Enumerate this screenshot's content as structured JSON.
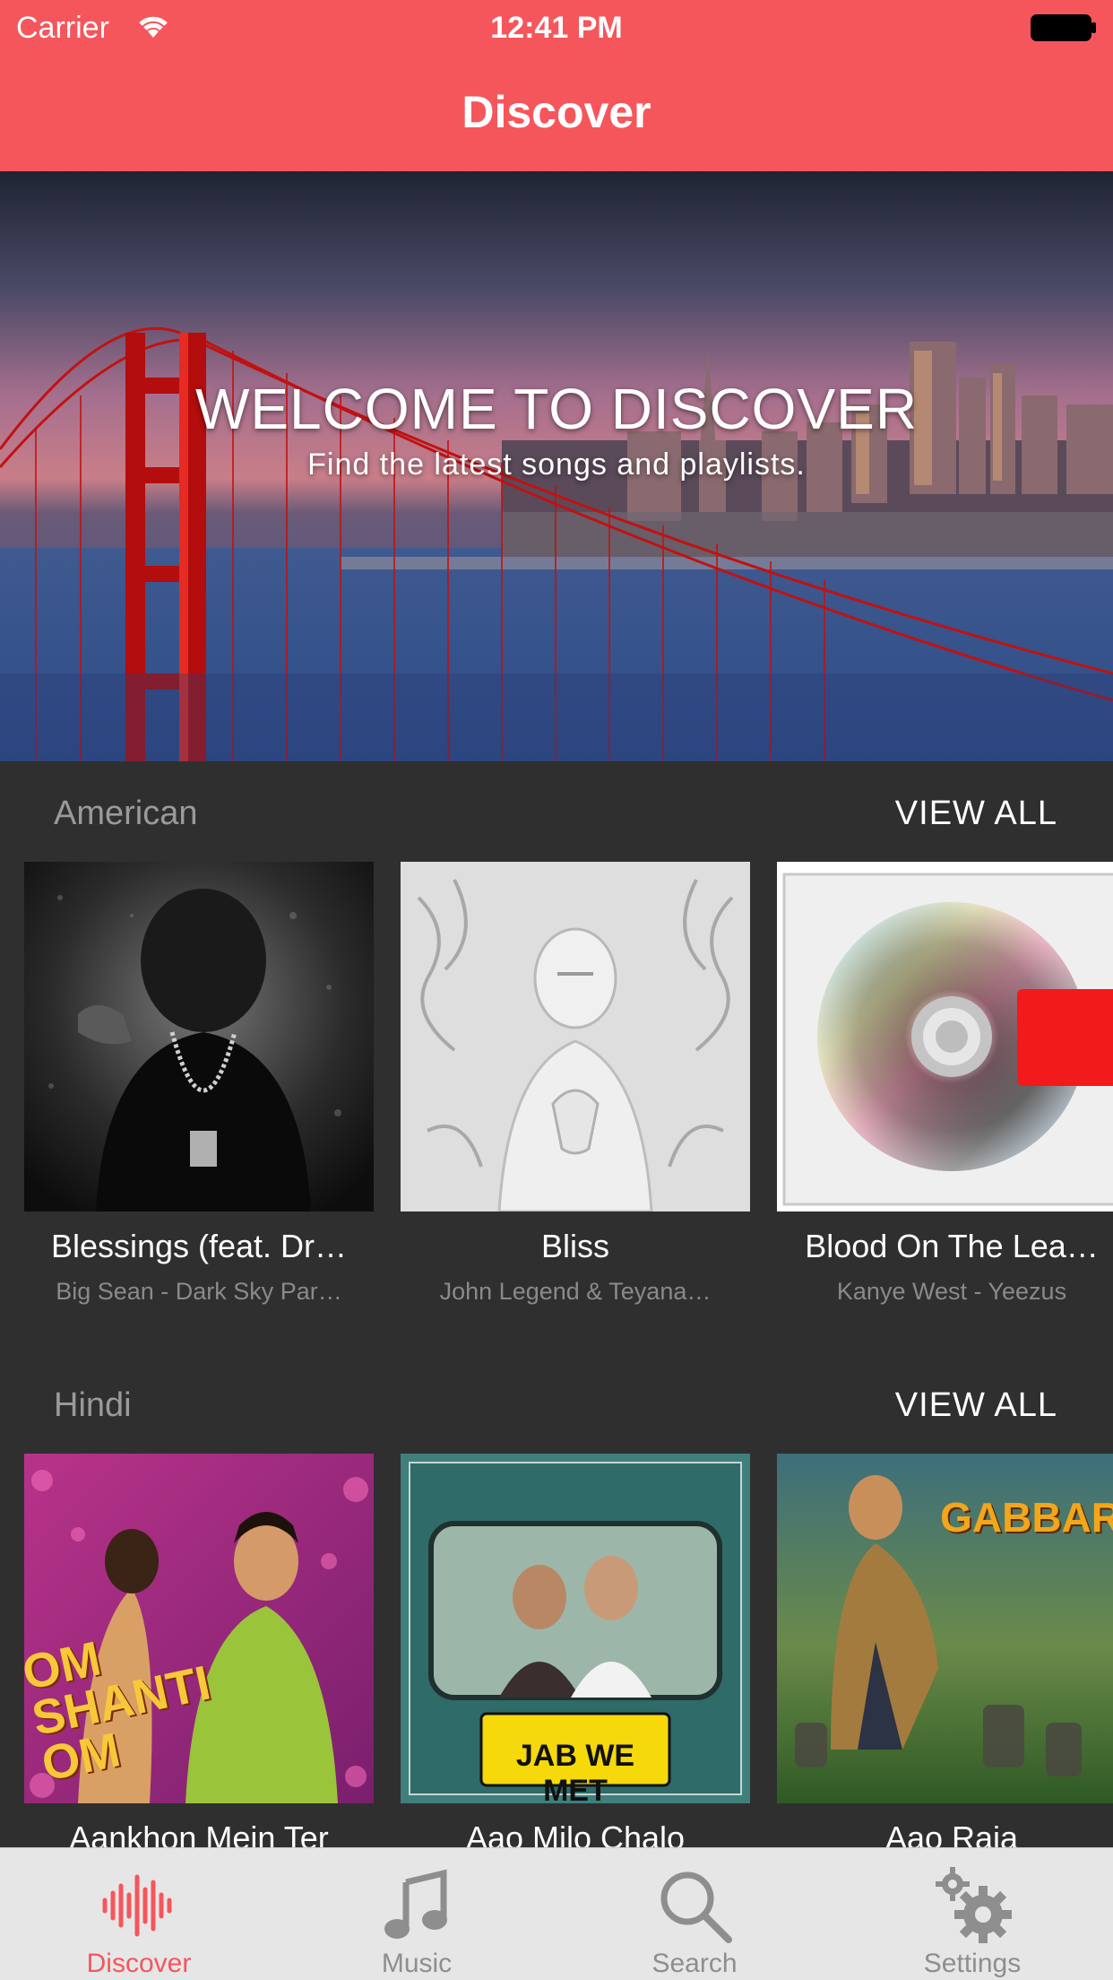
{
  "status_bar": {
    "carrier": "Carrier",
    "time": "12:41 PM"
  },
  "nav": {
    "title": "Discover"
  },
  "hero": {
    "title": "WELCOME TO DISCOVER",
    "subtitle": "Find the latest songs and playlists."
  },
  "sections": [
    {
      "title": "American",
      "view_all": "VIEW ALL",
      "items": [
        {
          "title": "Blessings (feat. Dr…",
          "subtitle": "Big Sean - Dark Sky Par…"
        },
        {
          "title": "Bliss",
          "subtitle": "John Legend & Teyana…"
        },
        {
          "title": "Blood On The Lea…",
          "subtitle": "Kanye West - Yeezus"
        }
      ]
    },
    {
      "title": "Hindi",
      "view_all": "VIEW ALL",
      "items": [
        {
          "title": "Aankhon Mein Ter",
          "subtitle": ""
        },
        {
          "title": "Aao Milo Chalo",
          "subtitle": ""
        },
        {
          "title": "Aao Raja",
          "subtitle": ""
        }
      ]
    }
  ],
  "album_art_text": {
    "om_shanti_om": "OM SHANTI OM",
    "jab_we_met": "JAB WE MET",
    "gabbar": "GABBAR"
  },
  "tabs": [
    {
      "label": "Discover",
      "icon": "waveform-icon",
      "active": true
    },
    {
      "label": "Music",
      "icon": "music-note-icon",
      "active": false
    },
    {
      "label": "Search",
      "icon": "search-icon",
      "active": false
    },
    {
      "label": "Settings",
      "icon": "gear-icon",
      "active": false
    }
  ],
  "colors": {
    "accent": "#f5565c",
    "background": "#2f2f2f",
    "tabbar": "#e6e6e6",
    "inactive": "#8e8e8e"
  }
}
